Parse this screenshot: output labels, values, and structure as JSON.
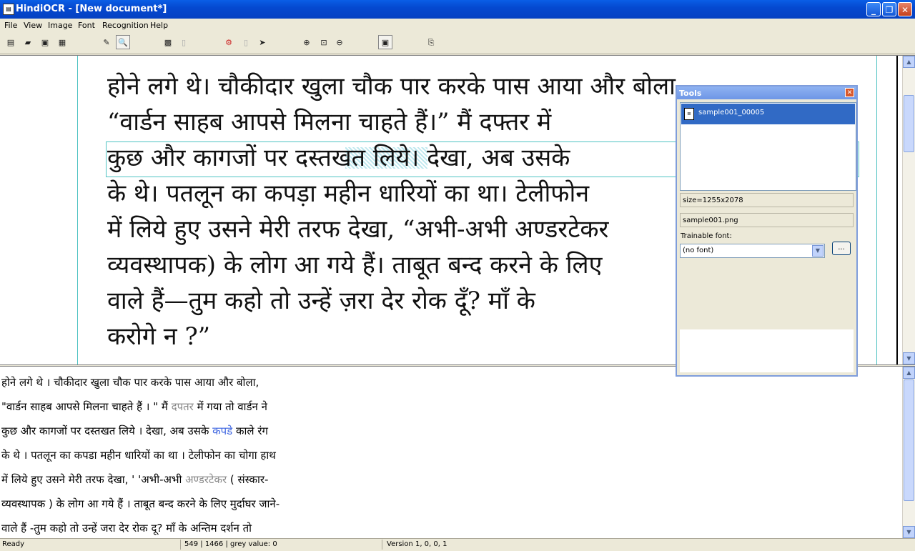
{
  "window": {
    "title": "HindiOCR - [New document*]",
    "app_icon": "page-icon",
    "minimize": "_",
    "restore": "❐",
    "close": "✕"
  },
  "menu": [
    "File",
    "View",
    "Image",
    "Font",
    "Recognition",
    "Help"
  ],
  "toolbar": {
    "icons": [
      "new-icon",
      "open-icon",
      "save-icon",
      "properties-icon",
      "new-selection-icon",
      "zoom-icon",
      "grid-icon",
      "blank-icon",
      "recognize-icon",
      "blank-icon",
      "export-icon",
      "zoom-in-icon",
      "zoom-fit-icon",
      "zoom-out-icon",
      "screen-icon",
      "copy-icon"
    ],
    "glyphs": [
      "▤",
      "▰",
      "▣",
      "▦",
      "✎",
      "🔍",
      "▩",
      "▯",
      "⚙",
      "▯",
      "➤",
      "⊕",
      "⊡",
      "⊖",
      "▣",
      "⎘"
    ]
  },
  "image_text": [
    "होने लगे थे। चौकीदार खुला चौक पार करके पास आया और बोला,",
    "“वार्डन साहब आपसे मिलना चाहते हैं।” मैं दफ्तर में",
    "कुछ और कागजों पर दस्तखत लिये। देखा, अब उसके",
    "के थे। पतलून का कपड़ा महीन धारियों का था। टेलीफोन",
    "में लिये हुए उसने मेरी तरफ देखा, “अभी-अभी अण्डरटेकर",
    "व्यवस्थापक) के लोग आ गये हैं। ताबूत बन्द करने के लिए",
    "वाले हैं—तुम कहो तो उन्हें ज़रा देर रोक दूँ? माँ के",
    "करोगे न ?”"
  ],
  "ocr_lines": [
    [
      "होने लगे थे । चौकीदार खुला चौक पार करके पास आया और बोला,"
    ],
    [
      "\"वार्डन साहब आपसे मिलना चाहते हैं । \" मैं ",
      {
        "t": "दपतर",
        "c": "gray"
      },
      " में गया तो वार्डन ने"
    ],
    [
      "कुछ और कागजों पर दस्तखत लिये । देखा, अब उसके ",
      {
        "t": "कपडे",
        "c": "blue"
      },
      " काले रंग"
    ],
    [
      "के थे । पतलून का कपडा महीन धारियों का था । टेलीफोन का चोगा हाथ"
    ],
    [
      "में लिये हुए उसने मेरी तरफ देखा, ' 'अभी-अभी ",
      {
        "t": "अण्डरटेकर",
        "c": "gray"
      },
      " ( संस्कार-"
    ],
    [
      "व्यवस्थापक ) के लोग आ गये हैं । ताबूत बन्द करने के लिए मुर्दाघर जाने-"
    ],
    [
      "वाले हैं -तुम कहो तो उन्हें जरा देर रोक दू? माँ के अन्तिम दर्शन तो"
    ]
  ],
  "status": {
    "ready": "Ready",
    "coords": "549 | 1466 | grey value: 0",
    "version": "Version 1, 0, 0, 1"
  },
  "tools": {
    "title": "Tools",
    "close": "✕",
    "file_item": "sample001_00005",
    "size": "size=1255x2078",
    "filename": "sample001.png",
    "font_label": "Trainable font:",
    "font_value": "(no font)",
    "browse": "..."
  },
  "scroll": {
    "up": "▲",
    "down": "▼"
  }
}
